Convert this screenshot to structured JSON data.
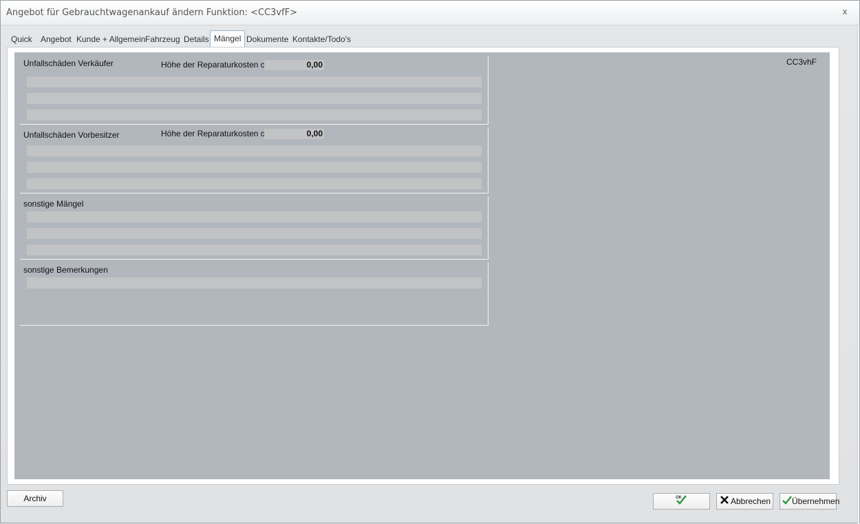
{
  "window": {
    "title": "Angebot für Gebrauchtwagenankauf ändern   Funktion: <CC3vfF>",
    "close_glyph": "x"
  },
  "tabs": [
    {
      "label": "Quick",
      "active": false
    },
    {
      "label": "Angebot",
      "active": false
    },
    {
      "label": "Kunde + Allgemein",
      "active": false
    },
    {
      "label": "Fahrzeug",
      "active": false
    },
    {
      "label": "Details",
      "active": false
    },
    {
      "label": "Mängel",
      "active": true
    },
    {
      "label": "Dokumente",
      "active": false
    },
    {
      "label": "Kontakte/Todo's",
      "active": false
    }
  ],
  "code_label": "CC3vhF",
  "groups": {
    "unfall_verkaeufer": {
      "label": "Unfallschäden Verkäufer",
      "cost_label": "Höhe der Reparaturkosten ca.",
      "cost_value": "0,00",
      "lines": [
        "",
        "",
        ""
      ]
    },
    "unfall_vorbesitzer": {
      "label": "Unfallschäden Vorbesitzer",
      "cost_label": "Höhe der Reparaturkosten ca.",
      "cost_value": "0,00",
      "lines": [
        "",
        "",
        ""
      ]
    },
    "sonstige_maengel": {
      "label": "sonstige Mängel",
      "lines": [
        "",
        "",
        ""
      ]
    },
    "sonstige_bemerkungen": {
      "label": "sonstige Bemerkungen",
      "lines": [
        ""
      ]
    }
  },
  "buttons": {
    "archiv": "Archiv",
    "ok": "OK",
    "abbrechen": "Abbrechen",
    "uebernehmen": "Übernehmen"
  },
  "icons": {
    "ok": "check-ok-icon",
    "abbrechen": "x-cancel-icon",
    "uebernehmen": "checkmark-icon"
  },
  "colors": {
    "content_bg": "#b2b6bd",
    "field_bg": "#c2c3c4",
    "check_green": "#2e9a3a"
  }
}
